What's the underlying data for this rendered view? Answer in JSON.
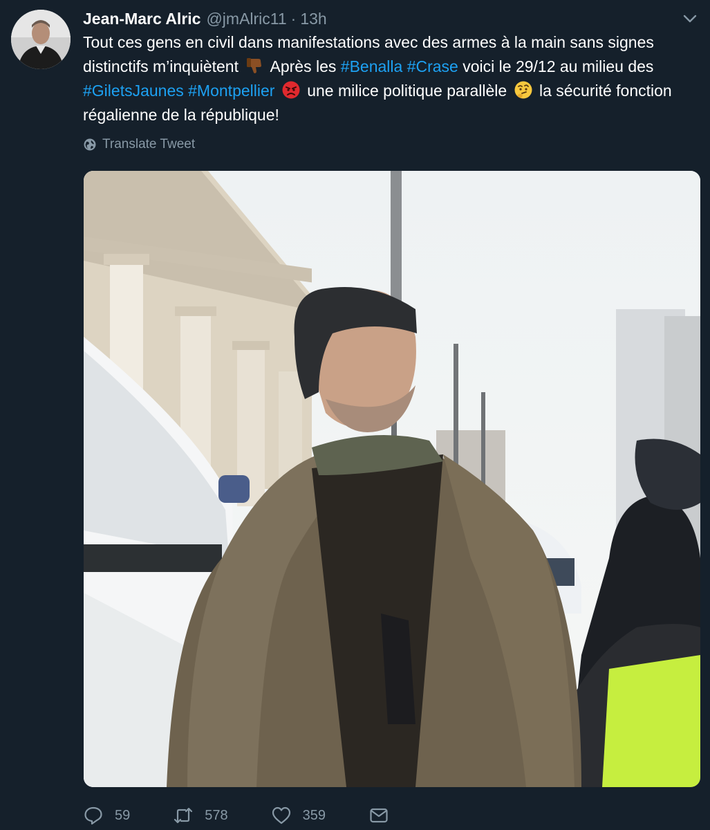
{
  "tweet": {
    "display_name": "Jean-Marc Alric",
    "handle": "@jmAlric11",
    "separator": "·",
    "time": "13h",
    "text": {
      "p1": "Tout ces gens en civil dans manifestations avec des armes à la main sans signes distinctifs m’inquiètent ",
      "p2": " Après les ",
      "tag1": "#Benalla",
      "tag2": "#Crase",
      "p3": " voici le 29/12 au milieu des ",
      "tag3": "#GiletsJaunes",
      "tag4": "#Montpellier",
      "p4": " une milice politique parallèle ",
      "p5": " la sécurité fonction régalienne de la république!"
    },
    "translate_label": "Translate Tweet"
  },
  "stats": {
    "replies": "59",
    "retweets": "578",
    "likes": "359"
  },
  "icons": {
    "avatar": "avatar-photo",
    "menu": "chevron-down-icon",
    "translate": "globe-icon",
    "reply": "reply-icon",
    "retweet": "retweet-icon",
    "like": "heart-icon",
    "dm": "envelope-icon"
  },
  "colors": {
    "background": "#15202b",
    "text": "#ffffff",
    "muted": "#8899a6",
    "link": "#1da1f2"
  }
}
